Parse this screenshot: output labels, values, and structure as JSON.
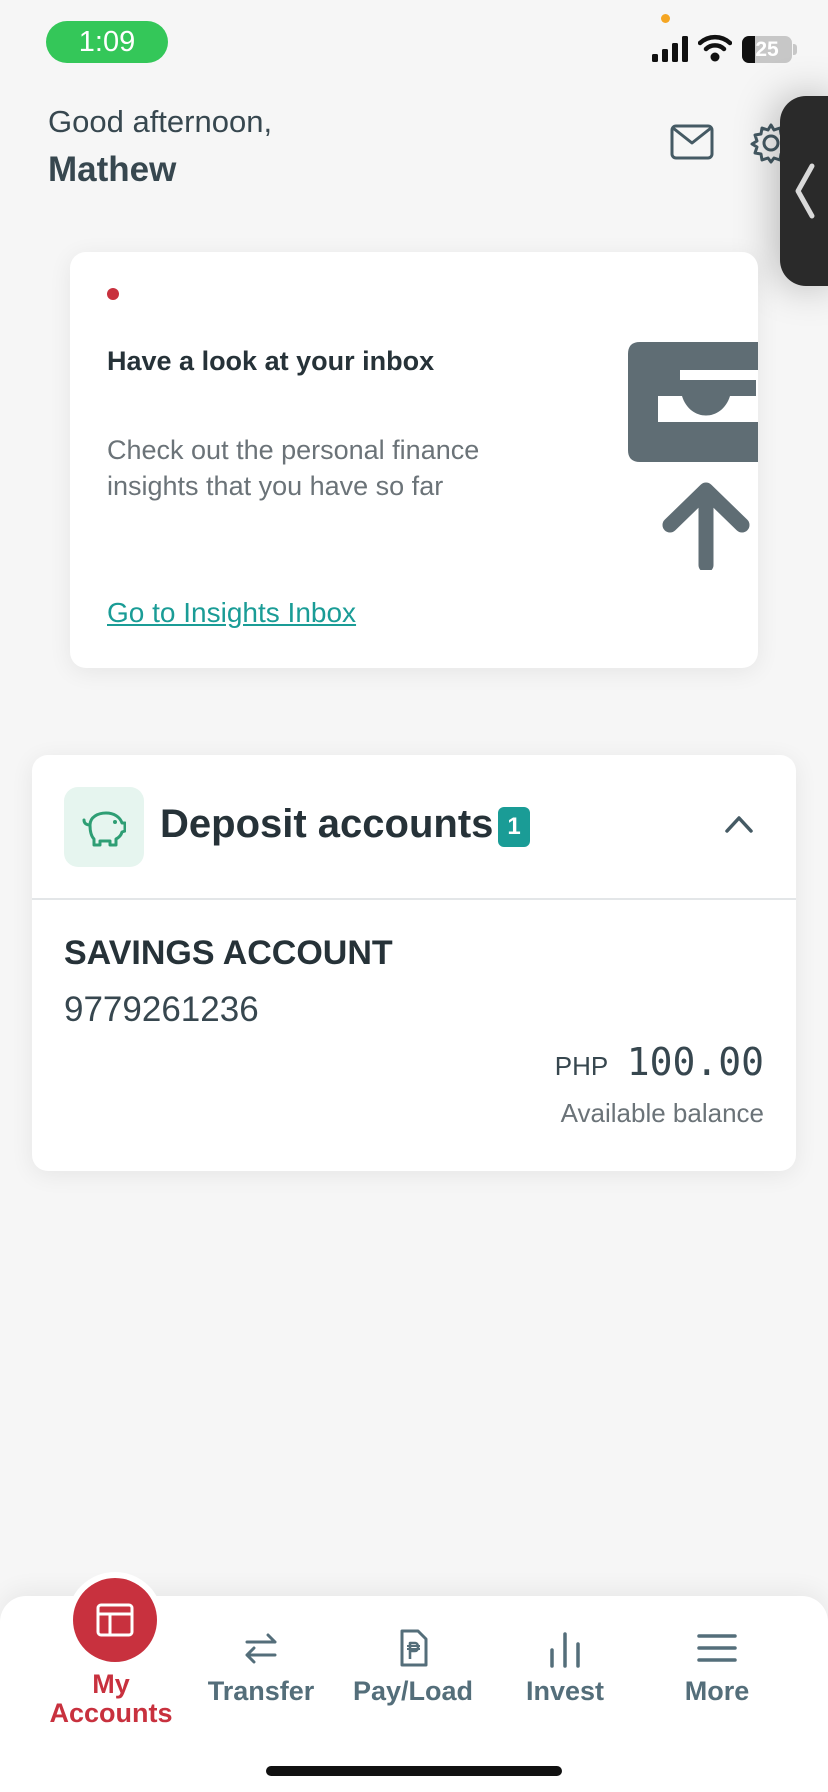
{
  "status_bar": {
    "time": "1:09",
    "battery": "25"
  },
  "header": {
    "greeting": "Good afternoon,",
    "name": "Mathew"
  },
  "insights_card": {
    "title": "Have a look at your inbox",
    "description": "Check out the personal finance insights that you have so far",
    "link": "Go to Insights Inbox"
  },
  "deposit_accounts": {
    "title": "Deposit accounts",
    "count": "1",
    "accounts": [
      {
        "name": "SAVINGS ACCOUNT",
        "number": "9779261236",
        "currency": "PHP",
        "amount": "100.00",
        "balance_label": "Available balance"
      }
    ]
  },
  "bottom_nav": {
    "items": [
      {
        "label": "My Accounts",
        "icon": "accounts-icon",
        "active": true
      },
      {
        "label": "Transfer",
        "icon": "transfer-icon"
      },
      {
        "label": "Pay/Load",
        "icon": "pay-load-icon"
      },
      {
        "label": "Invest",
        "icon": "invest-icon"
      },
      {
        "label": "More",
        "icon": "menu-icon"
      }
    ]
  },
  "colors": {
    "brand_red": "#c8313e",
    "teal": "#1a9c96",
    "status_green": "#34c759",
    "text_dark": "#263238"
  }
}
